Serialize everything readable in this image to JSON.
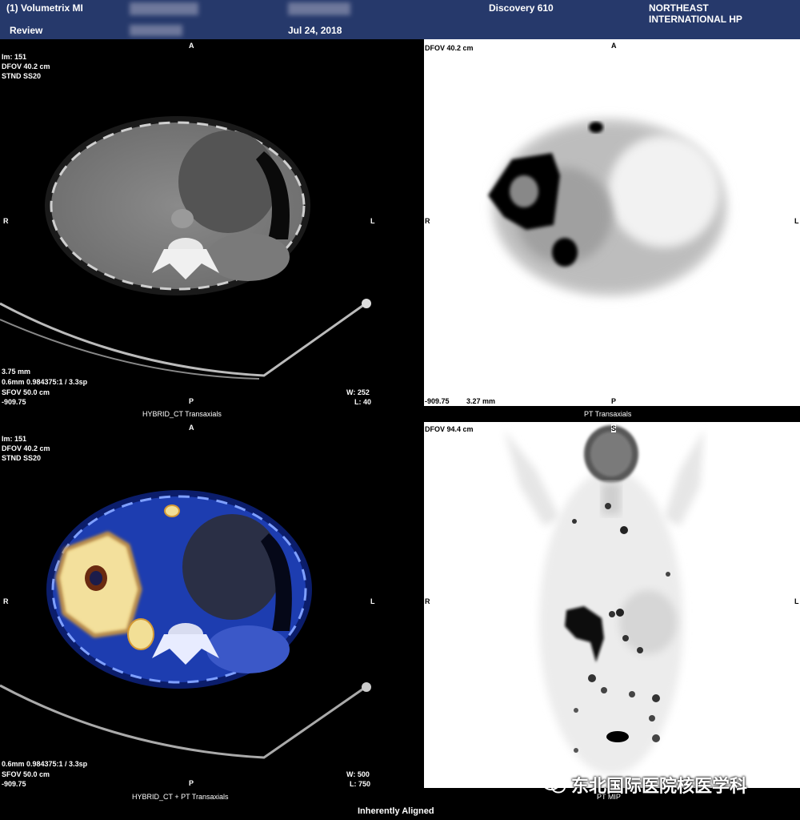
{
  "header": {
    "title": "(1) Volumetrix MI",
    "mode": "Review",
    "date": "Jul 24, 2018",
    "scanner": "Discovery 610",
    "institution_line1": "NORTHEAST",
    "institution_line2": "INTERNATIONAL HP"
  },
  "ct": {
    "top_orient": "A",
    "left_orient": "R",
    "right_orient": "L",
    "bottom_orient": "P",
    "info_line1": "Im: 151",
    "info_line2": "DFOV 40.2 cm",
    "info_line3": "STND SS20",
    "bl_line1": "3.75 mm",
    "bl_line2": "0.6mm 0.984375:1 / 3.3sp",
    "bl_line3": "SFOV 50.0 cm",
    "bl_line4": "-909.75",
    "window": "W: 252",
    "level": "L: 40",
    "caption": "HYBRID_CT Transaxials"
  },
  "pt": {
    "dfov": "DFOV 40.2 cm",
    "top_orient": "A",
    "left_orient": "R",
    "right_orient": "L",
    "bottom_orient": "P",
    "bl_value": "-909.75",
    "bl_thickness": "3.27 mm",
    "caption": "PT Transaxials"
  },
  "fusion": {
    "top_orient": "A",
    "left_orient": "R",
    "right_orient": "L",
    "bottom_orient": "P",
    "info_line1": "Im: 151",
    "info_line2": "DFOV 40.2 cm",
    "info_line3": "STND SS20",
    "bl_line1": "0.6mm 0.984375:1 / 3.3sp",
    "bl_line2": "SFOV 50.0 cm",
    "bl_line3": "-909.75",
    "window": "W: 500",
    "level": "L: 750",
    "caption": "HYBRID_CT + PT Transaxials"
  },
  "mip": {
    "dfov": "DFOV 94.4 cm",
    "top_orient": "S",
    "left_orient": "R",
    "right_orient": "L",
    "caption": "PT MIP"
  },
  "footer": {
    "alignment": "Inherently Aligned"
  },
  "watermark": {
    "text": "东北国际医院核医学科",
    "icon": "wechat-icon"
  }
}
